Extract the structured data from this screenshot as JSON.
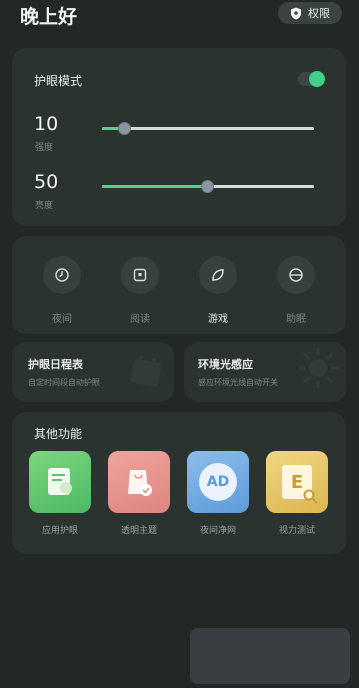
{
  "header": {
    "greeting": "晚上好",
    "permission_label": "权限"
  },
  "eye_mode": {
    "title": "护眼模式",
    "enabled": true,
    "strength": {
      "value": "10",
      "label": "强度",
      "level": 0.1
    },
    "brightness": {
      "value": "50",
      "label": "亮度",
      "level": 0.5
    }
  },
  "modes": [
    {
      "label": "夜间",
      "icon": "moon-clock-icon",
      "active": false
    },
    {
      "label": "阅读",
      "icon": "book-square-icon",
      "active": false
    },
    {
      "label": "游戏",
      "icon": "leaf-icon",
      "active": true
    },
    {
      "label": "助眠",
      "icon": "sleep-circle-icon",
      "active": false
    }
  ],
  "schedule": {
    "title": "护眼日程表",
    "subtitle": "自定时间段自动护眼",
    "icon": "calendar-icon"
  },
  "ambient": {
    "title": "环境光感应",
    "subtitle": "感应环境光线自动开关",
    "icon": "sun-icon"
  },
  "other": {
    "title": "其他功能",
    "items": [
      {
        "label": "应用护眼",
        "icon": "app-doc-icon",
        "color": "#5ec870"
      },
      {
        "label": "透明主题",
        "icon": "shopping-bag-icon",
        "color": "#e5918a"
      },
      {
        "label": "夜间净网",
        "icon": "ad-icon",
        "text": "AD",
        "color": "#6da9e0"
      },
      {
        "label": "视力测试",
        "icon": "eye-chart-icon",
        "text": "E",
        "color": "#e6c56a"
      }
    ]
  },
  "colors": {
    "background": "#212826",
    "card": "#2b3330",
    "accent": "#3fcf87"
  }
}
